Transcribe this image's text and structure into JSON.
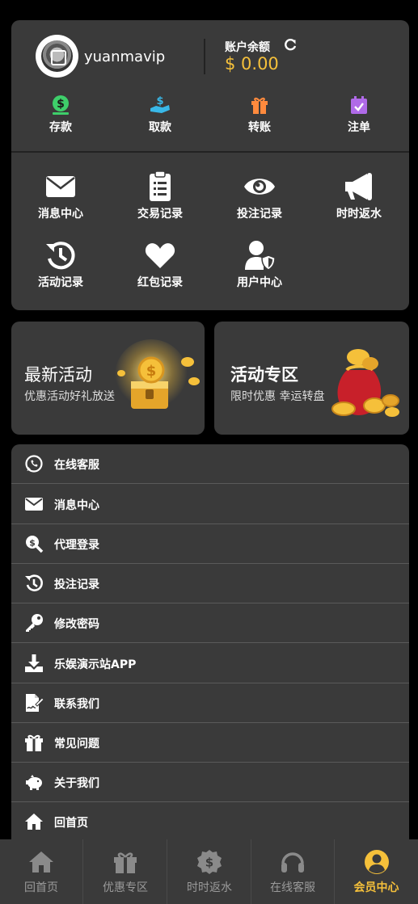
{
  "profile": {
    "username": "yuanmavip",
    "balance_label": "账户余额",
    "balance_value": "$ 0.00"
  },
  "quick_actions": [
    {
      "label": "存款",
      "icon": "deposit-icon",
      "color": "#3ecf6a"
    },
    {
      "label": "取款",
      "icon": "withdraw-icon",
      "color": "#39b8e8"
    },
    {
      "label": "转账",
      "icon": "gift-transfer-icon",
      "color": "#ff8a3d"
    },
    {
      "label": "注单",
      "icon": "calendar-check-icon",
      "color": "#b06ae8"
    }
  ],
  "menu_grid": [
    {
      "label": "消息中心",
      "icon": "envelope-icon"
    },
    {
      "label": "交易记录",
      "icon": "clipboard-list-icon"
    },
    {
      "label": "投注记录",
      "icon": "eye-icon"
    },
    {
      "label": "时时返水",
      "icon": "megaphone-icon"
    },
    {
      "label": "活动记录",
      "icon": "history-icon"
    },
    {
      "label": "红包记录",
      "icon": "heart-icon"
    },
    {
      "label": "用户中心",
      "icon": "user-shield-icon"
    }
  ],
  "promos": {
    "left": {
      "title": "最新活动",
      "subtitle": "优惠活动好礼放送"
    },
    "right": {
      "title": "活动专区",
      "subtitle": "限时优惠 幸运转盘"
    }
  },
  "list_items": [
    {
      "label": "在线客服",
      "icon": "whatsapp-icon"
    },
    {
      "label": "消息中心",
      "icon": "envelope-icon"
    },
    {
      "label": "代理登录",
      "icon": "search-dollar-icon"
    },
    {
      "label": "投注记录",
      "icon": "history-icon"
    },
    {
      "label": "修改密码",
      "icon": "key-icon"
    },
    {
      "label": "乐娱演示站APP",
      "icon": "download-icon"
    },
    {
      "label": "联系我们",
      "icon": "file-signature-icon"
    },
    {
      "label": "常见问题",
      "icon": "gift-icon"
    },
    {
      "label": "关于我们",
      "icon": "piggy-bank-icon"
    },
    {
      "label": "回首页",
      "icon": "home-icon"
    }
  ],
  "tabbar": [
    {
      "label": "回首页",
      "icon": "home-icon",
      "active": false
    },
    {
      "label": "优惠专区",
      "icon": "gift-icon",
      "active": false
    },
    {
      "label": "时时返水",
      "icon": "dollar-badge-icon",
      "active": false
    },
    {
      "label": "在线客服",
      "icon": "headset-icon",
      "active": false
    },
    {
      "label": "会员中心",
      "icon": "user-circle-icon",
      "active": true
    }
  ],
  "colors": {
    "accent": "#f5c03a",
    "card": "#3a3a3a",
    "background": "#000000"
  }
}
